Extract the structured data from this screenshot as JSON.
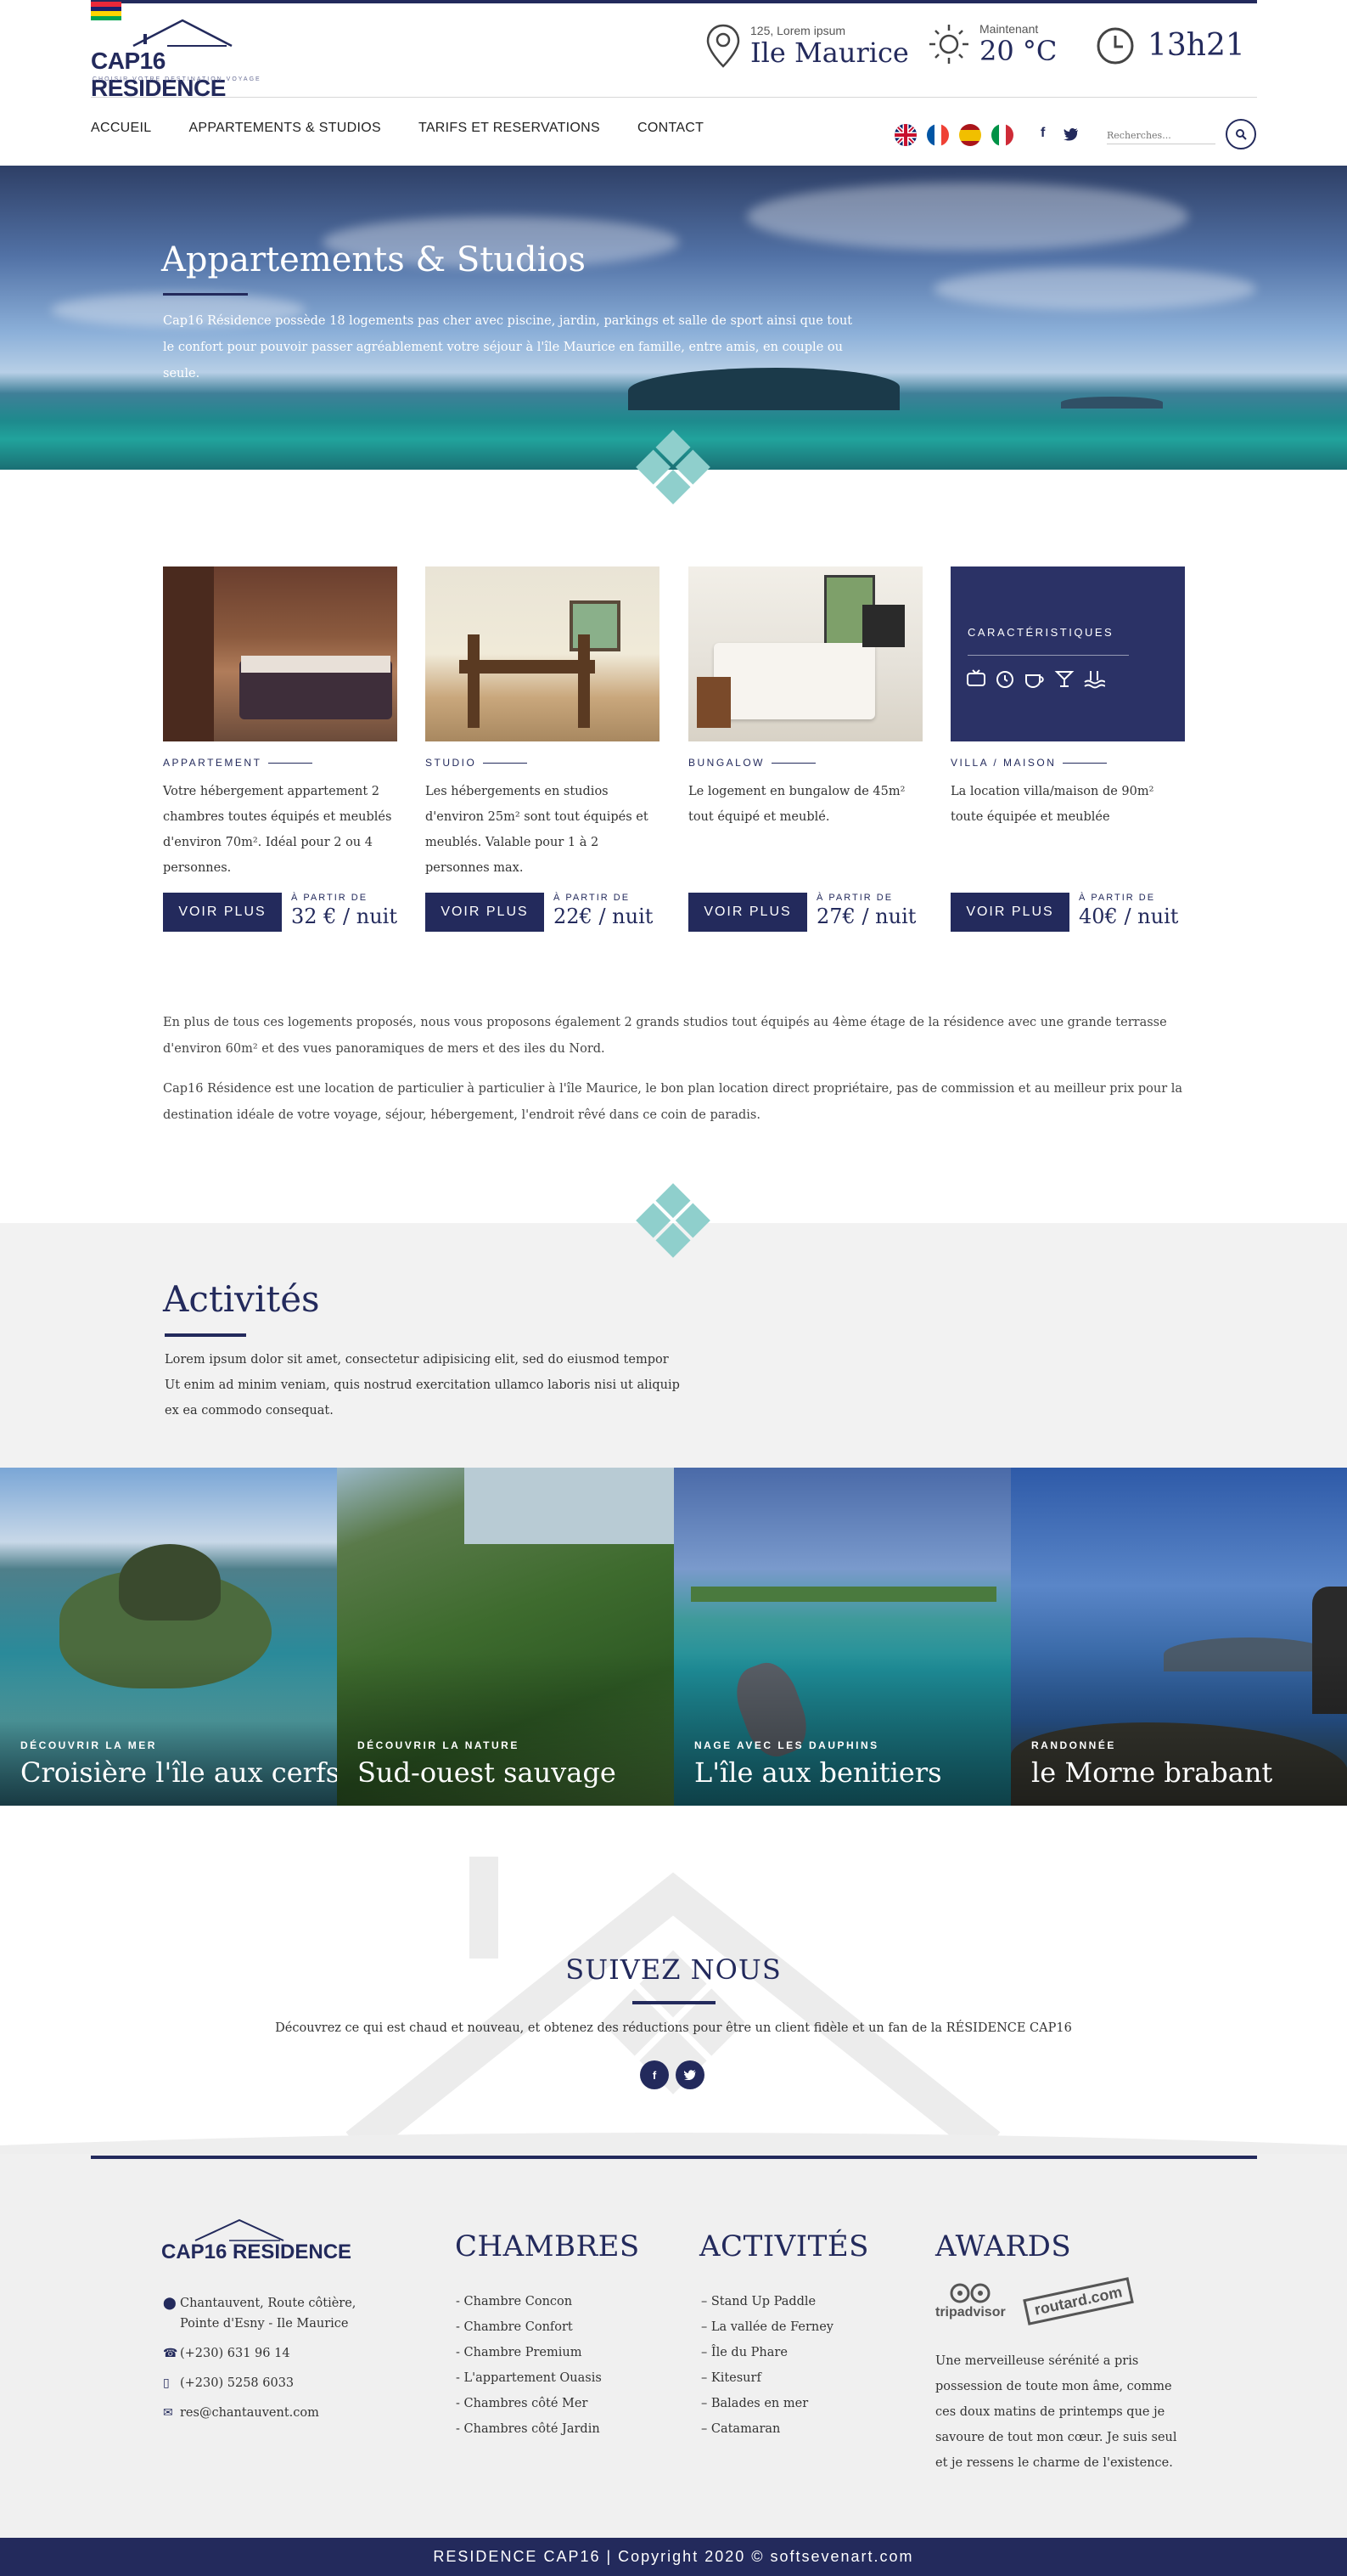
{
  "header": {
    "logo_text": "CAP16 RESIDENCE",
    "logo_tagline": "CHOISIR VOTRE DESTINATION VOYAGE",
    "address_small": "125, Lorem ipsum",
    "address_big": "Ile Maurice",
    "weather_small": "Maintenant",
    "weather_big": "20 °C",
    "time": "13h21",
    "search_placeholder": "Recherches..."
  },
  "nav": {
    "items": [
      "ACCUEIL",
      "APPARTEMENTS & STUDIOS",
      "TARIFS ET RESERVATIONS",
      "CONTACT"
    ]
  },
  "hero": {
    "title": "Appartements & Studios",
    "description": "Cap16 Résidence possède 18 logements pas cher avec piscine, jardin, parkings et salle de sport ainsi que tout le confort pour pouvoir passer agréablement votre séjour à l'île Maurice en famille, entre amis, en couple ou seule."
  },
  "rooms": [
    {
      "category": "APPARTEMENT",
      "text": "Votre hébergement appartement 2 chambres toutes équipés et meublés d'environ 70m². Idéal pour 2 ou 4 personnes.",
      "button": "VOIR PLUS",
      "from_label": "À PARTIR DE",
      "price": "32 € / nuit"
    },
    {
      "category": "STUDIO",
      "text": "Les hébergements en studios d'environ 25m² sont tout équipés et meublés. Valable pour 1 à 2 personnes max.",
      "button": "VOIR PLUS",
      "from_label": "À PARTIR DE",
      "price": "22€ / nuit"
    },
    {
      "category": "BUNGALOW",
      "text": "Le logement en bungalow de 45m² tout équipé et meublé.",
      "button": "VOIR PLUS",
      "from_label": "À PARTIR DE",
      "price": "27€ / nuit"
    },
    {
      "category": "VILLA / MAISON",
      "text": "La location villa/maison de 90m² toute équipée et meublée",
      "button": "VOIR PLUS",
      "from_label": "À PARTIR DE",
      "price": "40€ / nuit"
    }
  ],
  "features": {
    "title": "CARACTÉRISTIQUES",
    "icons": [
      "tv-icon",
      "alarm-clock-icon",
      "coffee-cup-icon",
      "cocktail-icon",
      "swimming-pool-icon"
    ]
  },
  "paragraphs": [
    "En plus de tous ces logements proposés, nous vous proposons également 2 grands studios tout équipés au 4ème étage de la résidence avec une grande terrasse d'environ 60m² et des vues panoramiques de mers et des iles du Nord.",
    "Cap16 Résidence est une location de particulier à particulier à l'île Maurice, le bon plan location direct propriétaire, pas de commission et au meilleur prix pour la destination idéale de votre voyage, séjour, hébergement, l'endroit rêvé dans ce coin de paradis."
  ],
  "activities": {
    "title": "Activités",
    "description": "Lorem ipsum dolor sit amet, consectetur adipisicing elit, sed do eiusmod tempor Ut enim ad minim veniam, quis nostrud exercitation ullamco laboris nisi ut aliquip ex ea commodo consequat.",
    "tiles": [
      {
        "sub": "DÉCOUVRIR LA MER",
        "title": "Croisière l'île aux cerfs"
      },
      {
        "sub": "DÉCOUVRIR LA NATURE",
        "title": "Sud-ouest sauvage"
      },
      {
        "sub": "NAGE AVEC LES DAUPHINS",
        "title": "L'île aux benitiers"
      },
      {
        "sub": "RANDONNÉE",
        "title": "le Morne brabant"
      }
    ]
  },
  "follow": {
    "title": "SUIVEZ NOUS",
    "description": "Découvrez ce qui est chaud et nouveau, et obtenez des réductions pour être un client fidèle et un fan de la RÉSIDENCE CAP16",
    "facebook": "f",
    "twitter": "t"
  },
  "footer": {
    "logo_text": "CAP16 RESIDENCE",
    "address_line1": "Chantauvent, Route côtière,",
    "address_line2": "Pointe d'Esny - Ile Maurice",
    "phone": "(+230) 631 96 14",
    "mobile": "(+230) 5258 6033",
    "email": "res@chantauvent.com",
    "chambres_title": "CHAMBRES",
    "chambres": [
      "- Chambre Concon",
      "- Chambre Confort",
      "- Chambre Premium",
      "- L'appartement Ouasis",
      "- Chambres côté Mer",
      "- Chambres côté Jardin"
    ],
    "activites_title": "ACTIVITÉS",
    "activites": [
      "– Stand Up Paddle",
      "– La vallée de Ferney",
      "– Île du Phare",
      "– Kitesurf",
      "– Balades en mer",
      "– Catamaran"
    ],
    "awards_title": "AWARDS",
    "award1": "tripadvisor",
    "award2": "routard.com",
    "awards_text": "Une merveilleuse sérénité a pris possession de toute mon âme, comme ces doux matins de printemps que je savoure de tout mon cœur. Je suis seul et je ressens le charme de l'existence.",
    "copyright": "RESIDENCE CAP16 | Copyright 2020 © softsevenart.com"
  }
}
